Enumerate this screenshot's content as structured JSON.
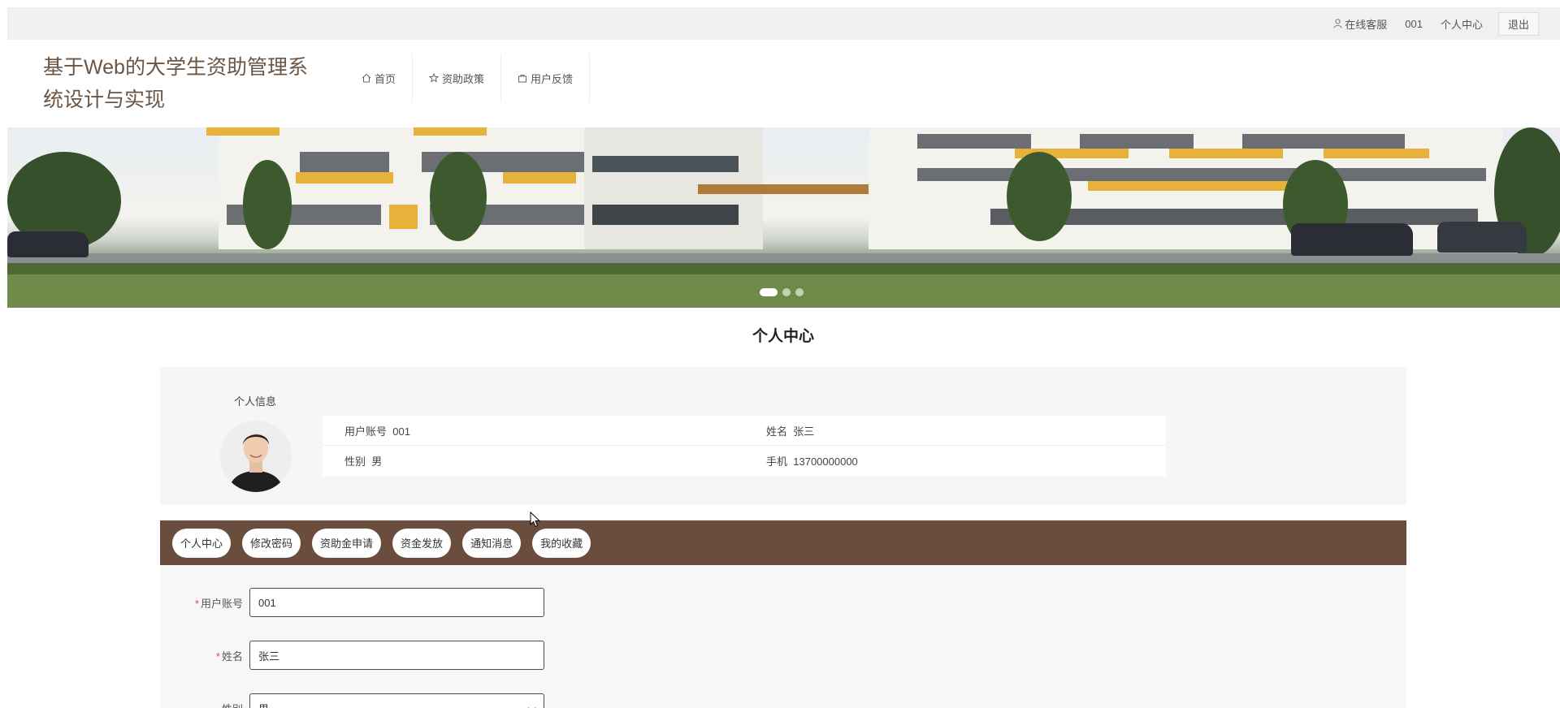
{
  "topbar": {
    "service_label": "在线客服",
    "user_account": "001",
    "profile_label": "个人中心",
    "logout_label": "退出"
  },
  "header": {
    "title": "基于Web的大学生资助管理系统设计与实现",
    "nav": [
      {
        "label": "首页",
        "icon": "home-icon"
      },
      {
        "label": "资助政策",
        "icon": "star-icon"
      },
      {
        "label": "用户反馈",
        "icon": "bag-icon"
      }
    ]
  },
  "banner": {
    "slide_count": 3,
    "active_index": 0
  },
  "page": {
    "title": "个人中心"
  },
  "profile": {
    "section_label": "个人信息",
    "rows": [
      [
        {
          "label": "用户账号",
          "value": "001"
        },
        {
          "label": "姓名",
          "value": "张三"
        }
      ],
      [
        {
          "label": "性别",
          "value": "男"
        },
        {
          "label": "手机",
          "value": "13700000000"
        }
      ]
    ]
  },
  "tabs": [
    "个人中心",
    "修改密码",
    "资助金申请",
    "资金发放",
    "通知消息",
    "我的收藏"
  ],
  "form": {
    "fields": [
      {
        "label": "用户账号",
        "value": "001",
        "required": true
      },
      {
        "label": "姓名",
        "value": "张三",
        "required": true
      },
      {
        "label": "性别",
        "value": "男",
        "required": false
      }
    ]
  },
  "colors": {
    "accent": "#6a4d3d",
    "title": "#6b5646",
    "required": "#e04444"
  }
}
